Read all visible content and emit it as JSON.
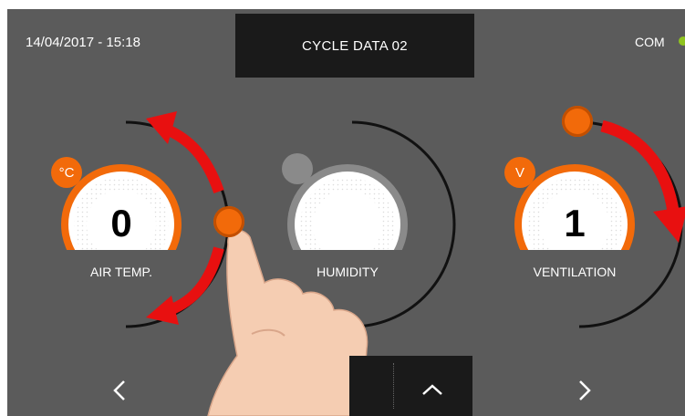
{
  "header": {
    "datetime": "14/04/2017 - 15:18",
    "title": "CYCLE DATA 02",
    "status_label": "COM"
  },
  "dials": [
    {
      "label": "AIR TEMP.",
      "value": "0",
      "unit": "°C",
      "active": true
    },
    {
      "label": "HUMIDITY",
      "value": "",
      "unit": "",
      "active": false
    },
    {
      "label": "VENTILATION",
      "value": "1",
      "unit": "V",
      "active": true
    }
  ],
  "nav": {
    "prev_icon": "chevron-left-icon",
    "next_icon": "chevron-right-icon",
    "up_icon": "chevron-up-icon"
  },
  "colors": {
    "accent": "#f26a0a",
    "background": "#5b5b5b",
    "panel": "#1a1a1a",
    "status_ok": "#8fc31f",
    "arrow": "#ee1111"
  }
}
